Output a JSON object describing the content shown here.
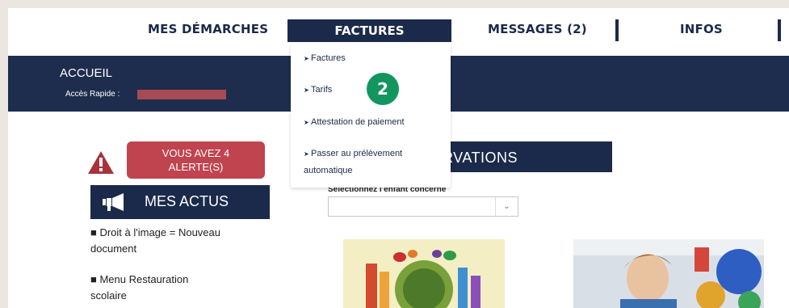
{
  "nav": {
    "items": [
      "MES DÉMARCHES",
      "FACTURES",
      "MESSAGES (2)",
      "INFOS"
    ]
  },
  "banner": {
    "title": "ACCUEIL",
    "quick_access": "Accès Rapide :"
  },
  "dropdown": {
    "items": [
      "Factures",
      "Tarifs",
      "Attestation de paiement",
      "Passer au prélèvement",
      "automatique"
    ]
  },
  "step_badge": "2",
  "alert": {
    "line1": "VOUS AVEZ 4",
    "line2": "ALERTE(S)"
  },
  "actus": {
    "title": "MES ACTUS",
    "items": [
      {
        "line1": "■ Droit à l'image = Nouveau",
        "line2": "document"
      },
      {
        "line1": "■ Menu Restauration",
        "line2": "scolaire"
      }
    ]
  },
  "reservations": {
    "title": "RVATIONS",
    "select_label": "Sélectionnez l'enfant concerné",
    "select_value": ""
  },
  "colors": {
    "navy": "#1b2a4a",
    "alert": "#c0444f",
    "badge": "#13955f"
  }
}
